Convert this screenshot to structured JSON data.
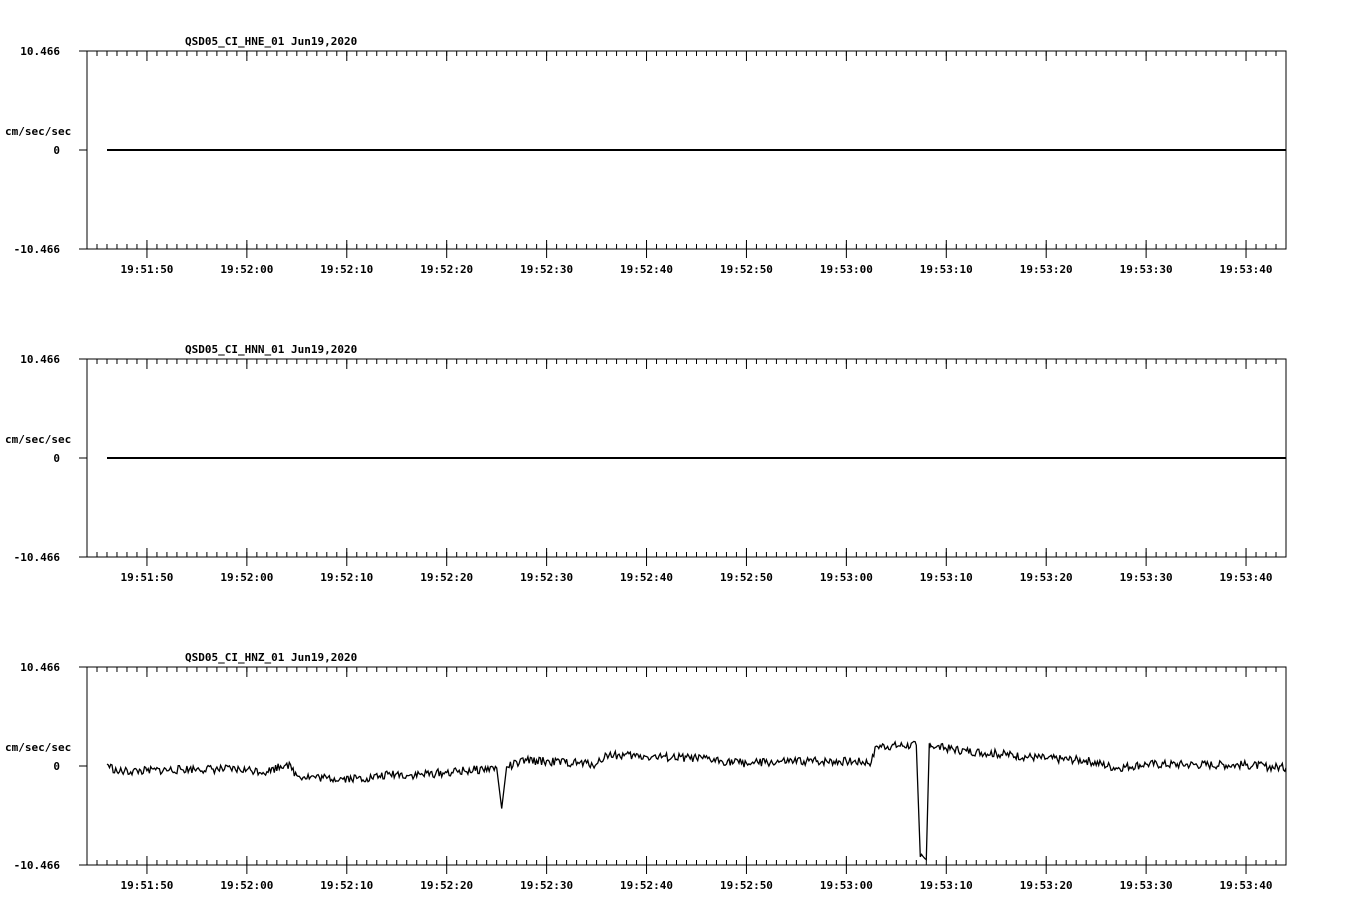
{
  "chart_data": [
    {
      "type": "line",
      "title": "QSD05_CI_HNE_01  Jun19,2020",
      "ylabel": "cm/sec/sec",
      "ylim": [
        -10.466,
        10.466
      ],
      "y_tick_labels": [
        "10.466",
        "0",
        "-10.466"
      ],
      "x_tick_labels": [
        "19:51:50",
        "19:52:00",
        "19:52:10",
        "19:52:20",
        "19:52:30",
        "19:52:40",
        "19:52:50",
        "19:53:00",
        "19:53:10",
        "19:53:20",
        "19:53:30",
        "19:53:40"
      ],
      "xlim": [
        "19:51:44",
        "19:53:44"
      ],
      "series": [
        {
          "x": [
            "19:51:46",
            "19:53:44"
          ],
          "values": [
            0,
            0
          ]
        }
      ]
    },
    {
      "type": "line",
      "title": "QSD05_CI_HNN_01  Jun19,2020",
      "ylabel": "cm/sec/sec",
      "ylim": [
        -10.466,
        10.466
      ],
      "y_tick_labels": [
        "10.466",
        "0",
        "-10.466"
      ],
      "x_tick_labels": [
        "19:51:50",
        "19:52:00",
        "19:52:10",
        "19:52:20",
        "19:52:30",
        "19:52:40",
        "19:52:50",
        "19:53:00",
        "19:53:10",
        "19:53:20",
        "19:53:30",
        "19:53:40"
      ],
      "xlim": [
        "19:51:44",
        "19:53:44"
      ],
      "series": [
        {
          "x": [
            "19:51:46",
            "19:53:44"
          ],
          "values": [
            0,
            0
          ]
        }
      ]
    },
    {
      "type": "line",
      "title": "QSD05_CI_HNZ_01  Jun19,2020",
      "ylabel": "cm/sec/sec",
      "ylim": [
        -10.466,
        10.466
      ],
      "y_tick_labels": [
        "10.466",
        "0",
        "-10.466"
      ],
      "x_tick_labels": [
        "19:51:50",
        "19:52:00",
        "19:52:10",
        "19:52:20",
        "19:52:30",
        "19:52:40",
        "19:52:50",
        "19:53:00",
        "19:53:10",
        "19:53:20",
        "19:53:30",
        "19:53:40"
      ],
      "xlim": [
        "19:51:44",
        "19:53:44"
      ],
      "series": [
        {
          "x": [
            "19:51:46",
            "19:51:47",
            "19:51:50",
            "19:51:55",
            "19:52:00",
            "19:52:02",
            "19:52:04",
            "19:52:05",
            "19:52:08",
            "19:52:12",
            "19:52:15",
            "19:52:16",
            "19:52:20",
            "19:52:25",
            "19:52:25.5",
            "19:52:26",
            "19:52:28",
            "19:52:35",
            "19:52:36",
            "19:52:40",
            "19:52:45",
            "19:52:50",
            "19:52:53",
            "19:52:56",
            "19:53:00",
            "19:53:02.5",
            "19:53:03",
            "19:53:07",
            "19:53:07.4",
            "19:53:08",
            "19:53:08.3",
            "19:53:08.4",
            "19:53:09",
            "19:53:12",
            "19:53:20",
            "19:53:24",
            "19:53:27",
            "19:53:30",
            "19:53:40",
            "19:53:44"
          ],
          "values": [
            0.2,
            -0.6,
            -0.5,
            -0.3,
            -0.4,
            -0.6,
            0.3,
            -1.0,
            -1.3,
            -1.3,
            -0.8,
            -1.0,
            -0.7,
            -0.2,
            -4.5,
            -0.1,
            0.6,
            0.2,
            1.2,
            1.0,
            0.8,
            0.3,
            0.4,
            0.5,
            0.5,
            0.4,
            2.1,
            2.2,
            -9.6,
            -9.9,
            2.4,
            2.3,
            2.0,
            1.6,
            0.8,
            0.6,
            -0.2,
            0.2,
            0.1,
            -0.2
          ]
        }
      ]
    }
  ]
}
